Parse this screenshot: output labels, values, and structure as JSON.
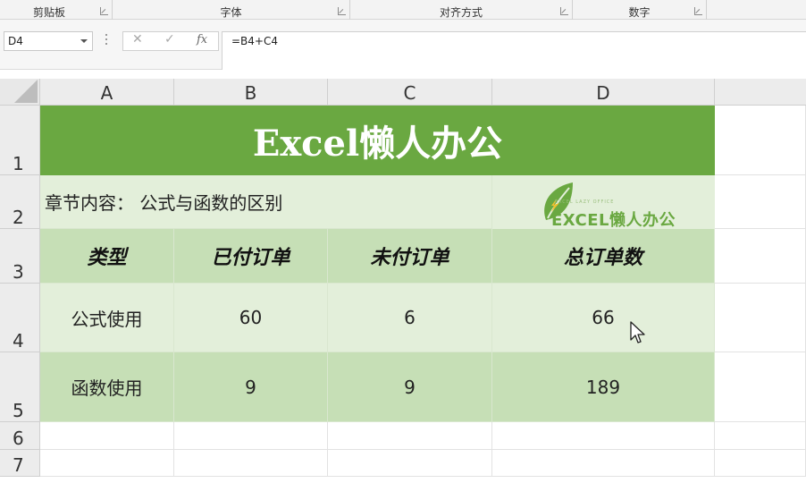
{
  "ribbon": {
    "groups": [
      {
        "label": "剪贴板"
      },
      {
        "label": "字体"
      },
      {
        "label": "对齐方式"
      },
      {
        "label": "数字"
      }
    ]
  },
  "formula_bar": {
    "name_box": "D4",
    "cancel_glyph": "✕",
    "enter_glyph": "✓",
    "fx_label": "fx",
    "formula": "=B4+C4"
  },
  "columns": [
    "A",
    "B",
    "C",
    "D"
  ],
  "rows": [
    "1",
    "2",
    "3",
    "4",
    "5",
    "6",
    "7"
  ],
  "sheet": {
    "title": "Excel懒人办公",
    "chapter": "章节内容：  公式与函数的区别",
    "logo_text": "EXCEL懒人办公",
    "logo_small_text": "EXCEL LAZY OFFICE",
    "headers": [
      "类型",
      "已付订单",
      "未付订单",
      "总订单数"
    ],
    "data_rows": [
      [
        "公式使用",
        "60",
        "6",
        "66"
      ],
      [
        "函数使用",
        "9",
        "9",
        "189"
      ]
    ]
  },
  "colors": {
    "title_bg": "#6aa841",
    "header_bg": "#c6dfb6",
    "light_row_bg": "#e3efda"
  }
}
